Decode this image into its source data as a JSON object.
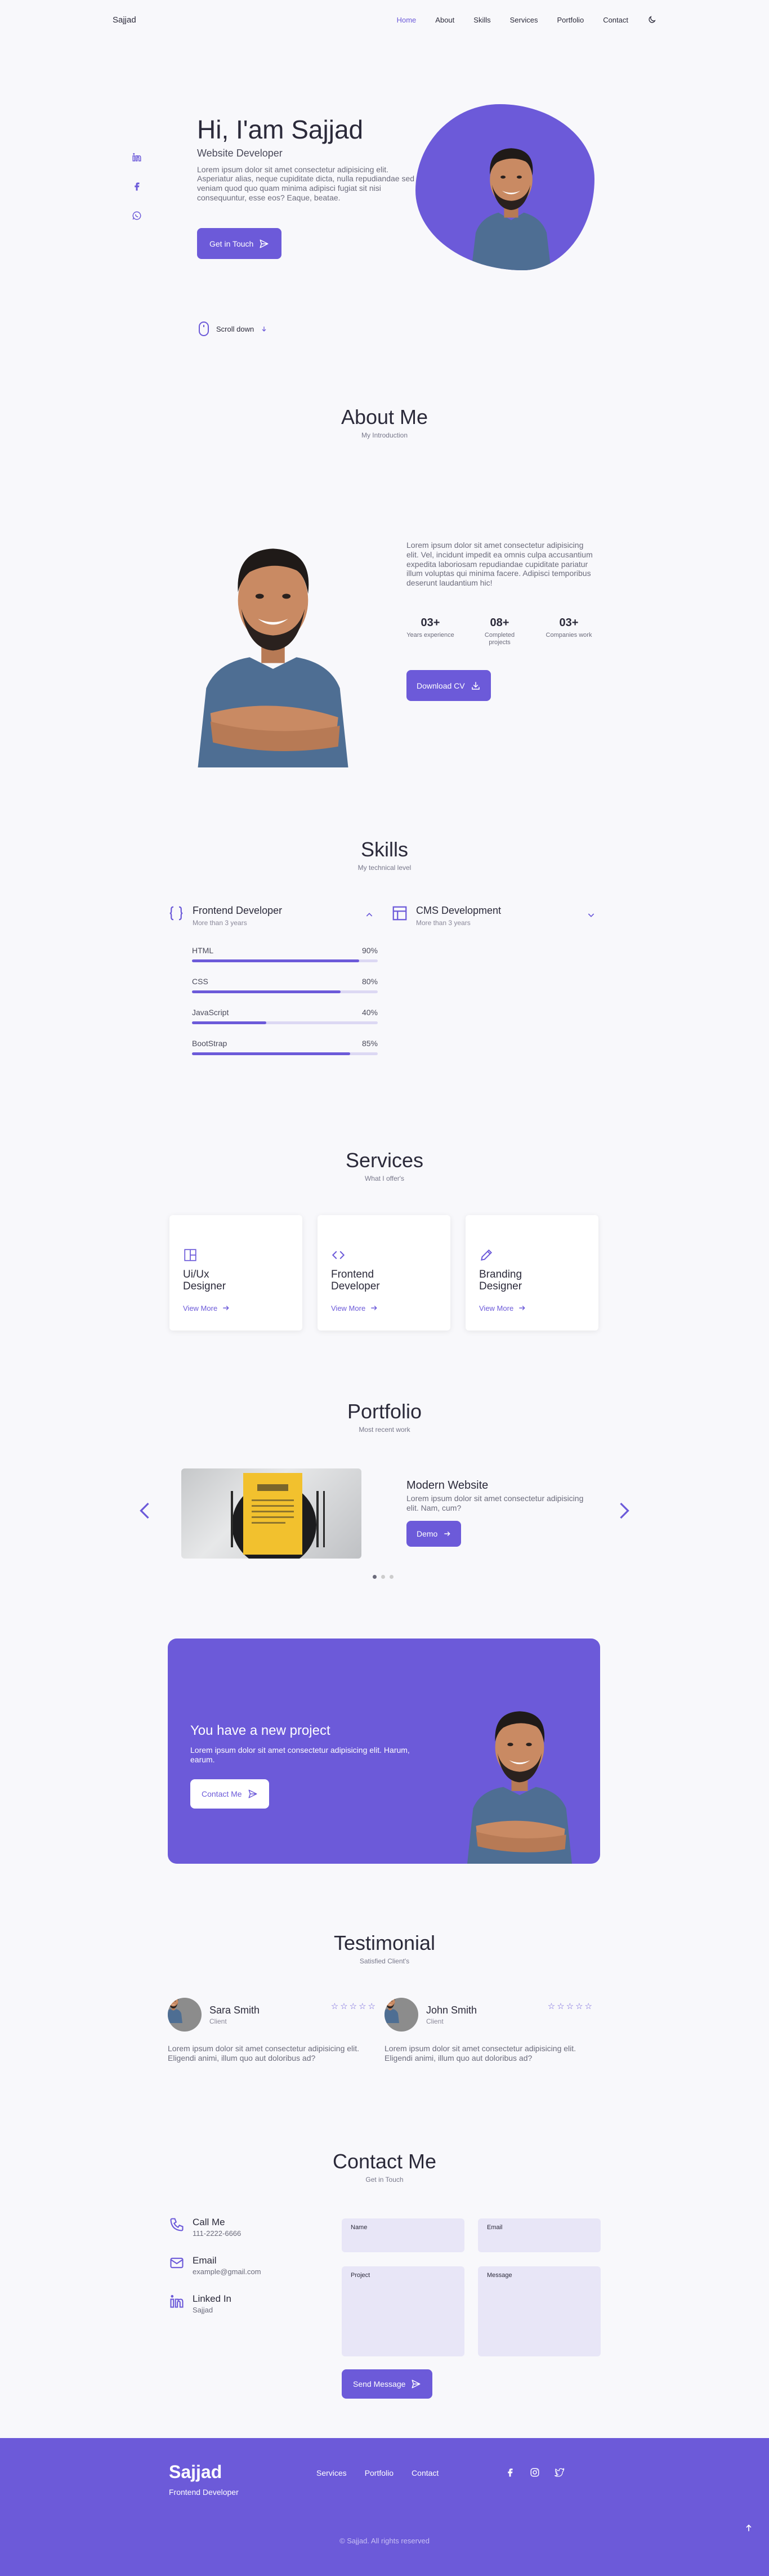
{
  "colors": {
    "accent": "#6c5ad9",
    "accent_light": "#e8e6f7",
    "background": "#f8f8fb",
    "text": "#2b2a3a"
  },
  "nav": {
    "logo": "Sajjad",
    "items": [
      {
        "label": "Home",
        "active": true
      },
      {
        "label": "About"
      },
      {
        "label": "Skills"
      },
      {
        "label": "Services"
      },
      {
        "label": "Portfolio"
      },
      {
        "label": "Contact"
      }
    ],
    "theme_icon": "moon-icon"
  },
  "hero": {
    "title": "Hi, I'am Sajjad",
    "subtitle": "Website Developer",
    "description": "Lorem ipsum dolor sit amet consectetur adipisicing elit. Asperiatur alias, neque cupiditate dicta, nulla repudiandae sed veniam quod quo quam minima adipisci fugiat sit nisi consequuntur, esse eos? Eaque, beatae.",
    "button": "Get in Touch",
    "scroll": "Scroll down",
    "social_icons": [
      "linkedin-icon",
      "facebook-icon",
      "whatsapp-icon"
    ]
  },
  "about": {
    "title": "About Me",
    "subtitle": "My Introduction",
    "description": "Lorem ipsum dolor sit amet consectetur adipisicing elit. Vel, incidunt impedit ea omnis culpa accusantium expedita laboriosam repudiandae cupiditate pariatur illum voluptas qui minima facere. Adipisci temporibus deserunt laudantium hic!",
    "stats": [
      {
        "number": "03+",
        "label": "Years experience"
      },
      {
        "number": "08+",
        "label": "Completed projects"
      },
      {
        "number": "03+",
        "label": "Companies work"
      }
    ],
    "button": "Download CV"
  },
  "skills": {
    "title": "Skills",
    "subtitle": "My technical level",
    "groups": [
      {
        "title": "Frontend Developer",
        "sub": "More than 3 years",
        "icon": "code-braces-icon"
      },
      {
        "title": "CMS Development",
        "sub": "More than 3 years",
        "icon": "layout-icon"
      }
    ],
    "bars": [
      {
        "name": "HTML",
        "percent": "90%",
        "value": 90
      },
      {
        "name": "CSS",
        "percent": "80%",
        "value": 80
      },
      {
        "name": "JavaScript",
        "percent": "40%",
        "value": 40
      },
      {
        "name": "BootStrap",
        "percent": "85%",
        "value": 85
      }
    ]
  },
  "services": {
    "title": "Services",
    "subtitle": "What I offer's",
    "items": [
      {
        "name": "Ui/Ux Designer",
        "icon": "layout-grid-icon",
        "link": "View More"
      },
      {
        "name": "Frontend Developer",
        "icon": "code-icon",
        "link": "View More"
      },
      {
        "name": "Branding Designer",
        "icon": "pencil-icon",
        "link": "View More"
      }
    ]
  },
  "portfolio": {
    "title": "Portfolio",
    "subtitle": "Most recent work",
    "project_title": "Modern Website",
    "project_desc": "Lorem ipsum dolor sit amet consectetur adipisicing elit. Nam, cum?",
    "button": "Demo"
  },
  "banner": {
    "title": "You have a new project",
    "description": "Lorem ipsum dolor sit amet consectetur adipisicing elit. Harum, earum.",
    "button": "Contact Me"
  },
  "testimonial": {
    "title": "Testimonial",
    "subtitle": "Satisfied Client's",
    "items": [
      {
        "name": "Sara Smith",
        "role": "Client",
        "text": "Lorem ipsum dolor sit amet consectetur adipisicing elit. Eligendi animi, illum quo aut doloribus ad?",
        "rating": 5
      },
      {
        "name": "John Smith",
        "role": "Client",
        "text": "Lorem ipsum dolor sit amet consectetur adipisicing elit. Eligendi animi, illum quo aut doloribus ad?",
        "rating": 5
      }
    ]
  },
  "contact": {
    "title": "Contact Me",
    "subtitle": "Get in Touch",
    "info": [
      {
        "title": "Call Me",
        "value": "111-2222-6666",
        "icon": "phone-icon"
      },
      {
        "title": "Email",
        "value": "example@gmail.com",
        "icon": "mail-icon"
      },
      {
        "title": "Linked In",
        "value": "Sajjad",
        "icon": "linkedin-icon"
      }
    ],
    "fields": {
      "name": "Name",
      "email": "Email",
      "project": "Project",
      "message": "Message"
    },
    "button": "Send Message"
  },
  "footer": {
    "brand": "Sajjad",
    "role": "Frontend Developer",
    "links": [
      "Services",
      "Portfolio",
      "Contact"
    ],
    "social_icons": [
      "facebook-icon",
      "instagram-icon",
      "twitter-icon"
    ],
    "copyright": "© Sajjad. All rights reserved"
  }
}
